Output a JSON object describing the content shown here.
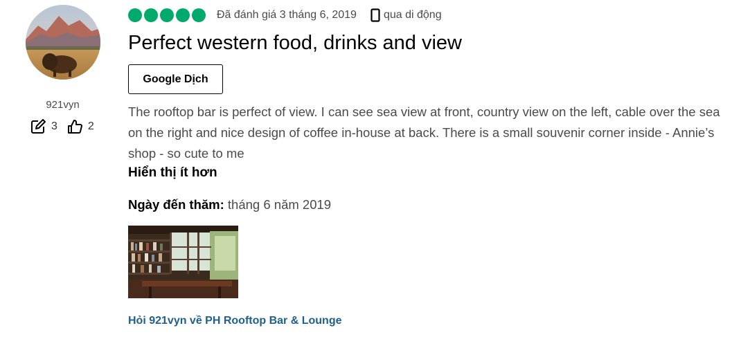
{
  "reviewer": {
    "username": "921vyn",
    "review_count": "3",
    "helpful_votes": "2",
    "avatar_icon": "bison-landscape-photo"
  },
  "review": {
    "rating_bubbles": 5,
    "rating_max": 5,
    "rating_color": "#00aa6c",
    "date_text": "Đã đánh giá 3 tháng 6, 2019",
    "via_mobile": "qua di động",
    "title": "Perfect western food, drinks and view",
    "translate_button": "Google Dịch",
    "body": "The rooftop bar is perfect of view. I can see sea view at front, country view on the left, cable over the sea on the right and nice design of coffee in-house at back. There is a small souvenir corner inside - Annie’s shop - so cute to me",
    "show_less": "Hiển thị ít hơn",
    "visit_label": "Ngày đến thăm:",
    "visit_value": "tháng 6 năm 2019",
    "photo_icon": "bookshelf-cafe-photo",
    "ask_link": "Hỏi 921vyn về PH Rooftop Bar & Lounge"
  }
}
